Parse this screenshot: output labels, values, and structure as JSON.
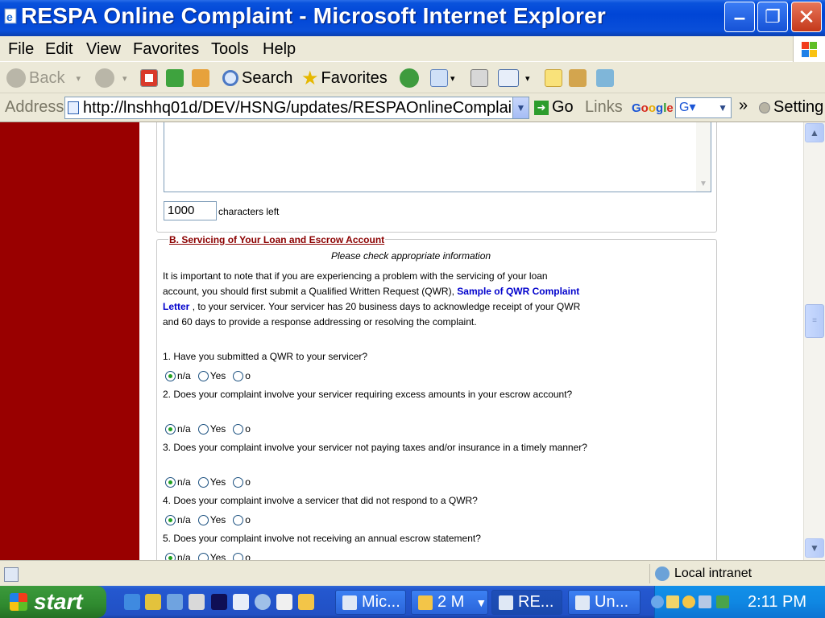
{
  "window": {
    "title": "RESPA Online Complaint - Microsoft Internet Explorer",
    "min_glyph": "–",
    "max_glyph": "❐",
    "close_glyph": "✕"
  },
  "menu": {
    "items": [
      "File",
      "Edit",
      "View",
      "Favorites",
      "Tools",
      "Help"
    ]
  },
  "toolbar": {
    "back": "Back",
    "search": "Search",
    "favorites": "Favorites"
  },
  "address": {
    "label": "Address",
    "url": "http://lnshhq01d/DEV/HSNG/updates/RESPAOnlineComplai",
    "go": "Go",
    "links": "Links",
    "google_brand": "Google",
    "google_value": "G▾",
    "chevron": "»",
    "settings": "Setting"
  },
  "form": {
    "chars_left_value": "1000",
    "chars_left_label": "characters left",
    "section_b_title": "B. Servicing of Your Loan and Escrow Account",
    "section_b_subtitle": "Please check appropriate information",
    "intro_text_1": "It is important to note that if you are experiencing a problem with the servicing of your loan account, you should first submit a Qualified Written Request (QWR), ",
    "intro_link": "Sample of QWR Complaint Letter ",
    "intro_text_2": ", to your servicer. Your servicer has 20 business days to acknowledge receipt of your QWR and 60 days to provide a response addressing or resolving the complaint.",
    "questions": [
      {
        "text": "1. Have you submitted a QWR to your servicer?",
        "opt_na": "n/a",
        "opt_yes": "Yes",
        "opt_no": "o"
      },
      {
        "text": "2. Does your complaint involve your servicer requiring excess amounts in your escrow account?",
        "opt_na": "n/a",
        "opt_yes": "Yes",
        "opt_no": "o"
      },
      {
        "text": "3. Does your complaint involve your servicer not paying taxes and/or insurance in a timely manner?",
        "opt_na": "n/a",
        "opt_yes": "Yes",
        "opt_no": "o"
      },
      {
        "text": "4. Does your complaint involve a servicer that did not respond to a QWR?",
        "opt_na": "n/a",
        "opt_yes": "Yes",
        "opt_no": "o"
      },
      {
        "text": "5. Does your complaint involve not receiving an annual escrow statement?",
        "opt_na": "n/a",
        "opt_yes": "Yes",
        "opt_no": "o"
      }
    ],
    "selected": "n/a"
  },
  "status": {
    "zone": "Local intranet"
  },
  "taskbar": {
    "start": "start",
    "tasks": [
      "Mic...",
      "2 M",
      "RE...",
      "Un..."
    ],
    "clock": "2:11 PM"
  },
  "colors": {
    "sidebar": "#990000",
    "section_title": "#8b0000",
    "link": "#0000cc",
    "radio_selected": "#21a121"
  }
}
